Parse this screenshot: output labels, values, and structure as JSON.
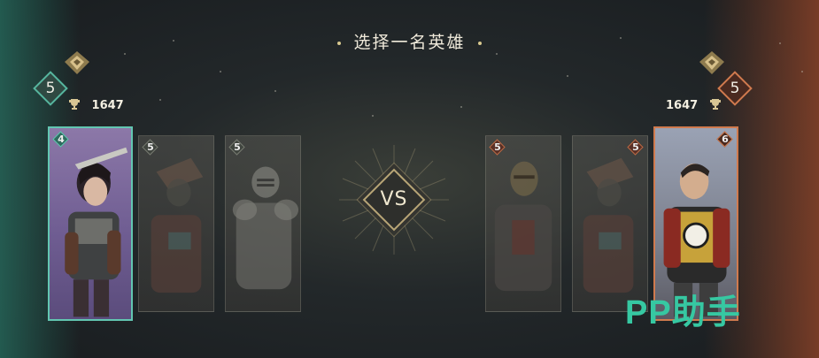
{
  "title": "选择一名英雄",
  "left_player": {
    "level": "5",
    "trophies": "1647",
    "team_color": "#3aa891",
    "cards": [
      {
        "level": "4",
        "state": "selected"
      },
      {
        "level": "5",
        "state": "dimmed"
      },
      {
        "level": "5",
        "state": "dimmed"
      }
    ]
  },
  "right_player": {
    "level": "5",
    "trophies": "1647",
    "team_color": "#c86a3c",
    "cards": [
      {
        "level": "5",
        "state": "dimmed"
      },
      {
        "level": "5",
        "state": "dimmed"
      },
      {
        "level": "6",
        "state": "selected"
      }
    ]
  },
  "versus_label": "VS",
  "watermark": "PP助手",
  "icons": [
    "emblem-icon",
    "trophy-icon",
    "level-diamond-icon"
  ]
}
